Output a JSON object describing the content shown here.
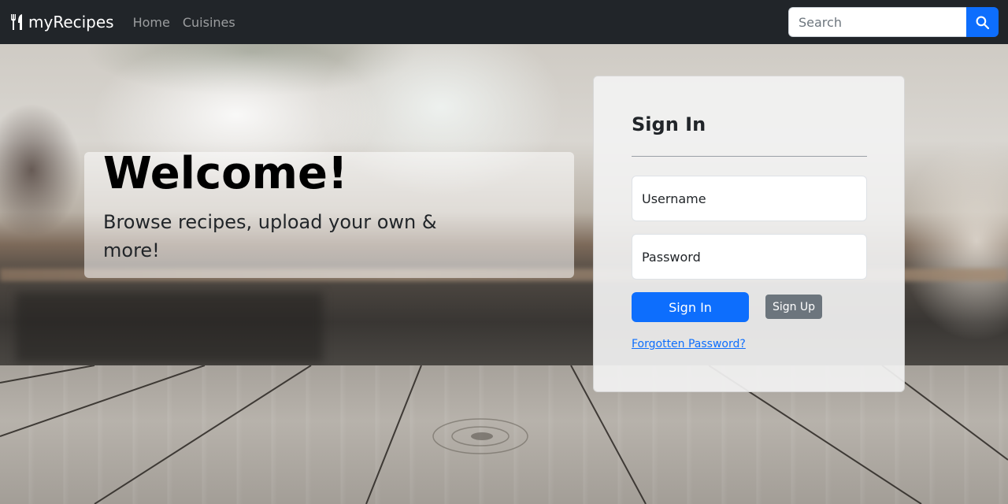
{
  "navbar": {
    "brand_icon": "utensils-icon",
    "brand": "myRecipes",
    "links": [
      "Home",
      "Cuisines"
    ],
    "search_placeholder": "Search",
    "search_icon": "search-icon"
  },
  "hero": {
    "title": "Welcome!",
    "subtitle": "Browse recipes, upload your own & more!"
  },
  "signin": {
    "title": "Sign In",
    "username_placeholder": "Username",
    "password_placeholder": "Password",
    "signin_label": "Sign In",
    "signup_label": "Sign Up",
    "forgot_label": "Forgotten Password?"
  },
  "colors": {
    "navbar_bg": "#212529",
    "primary": "#0d6efd",
    "secondary": "#6c757d"
  }
}
